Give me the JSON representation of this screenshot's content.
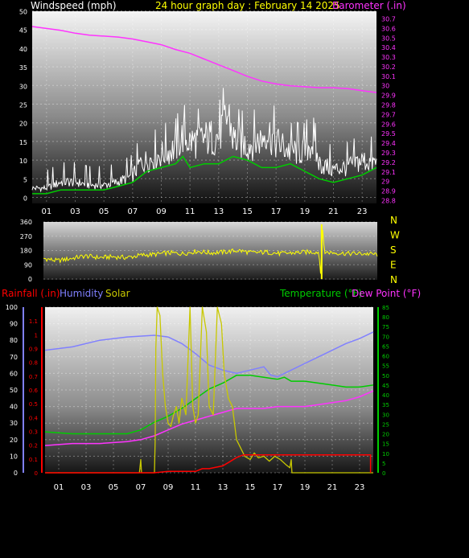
{
  "header": {
    "windspeed_label": "Windspeed (mph)",
    "title": "24 hour graph day : February 14 2025",
    "barometer_label": "Barometer (.in)"
  },
  "colors": {
    "background": "#000000",
    "axis_text": "#ffffff",
    "title": "#ffff00",
    "barometer": "#ff33ff",
    "wind_gust": "#ffffff",
    "wind_avg": "#00cc00",
    "direction": "#ffff00",
    "rainfall": "#ff0000",
    "humidity": "#8080ff",
    "solar": "#c8c800",
    "temperature": "#00cc00",
    "dewpoint": "#ff33ff"
  },
  "chart_data": [
    {
      "type": "line",
      "title": "24 hour graph day : February 14 2025",
      "x_ticks": [
        "01",
        "03",
        "05",
        "07",
        "09",
        "11",
        "13",
        "15",
        "17",
        "19",
        "21",
        "23"
      ],
      "y_left_label": "Windspeed (mph)",
      "y_left_ticks": [
        "0",
        "5",
        "10",
        "15",
        "20",
        "25",
        "30",
        "35",
        "40",
        "45",
        "50"
      ],
      "y_left_range": [
        0,
        50
      ],
      "y_right_label": "Barometer (.in)",
      "y_right_ticks": [
        "28.8",
        "28.9",
        "29",
        "29.1",
        "29.2",
        "29.3",
        "29.4",
        "29.5",
        "29.6",
        "29.7",
        "29.8",
        "29.9",
        "30",
        "30.1",
        "30.2",
        "30.3",
        "30.4",
        "30.5",
        "30.6",
        "30.7"
      ],
      "y_right_range": [
        28.77,
        30.78
      ],
      "x_range": [
        0,
        24
      ],
      "grid": true,
      "series": [
        {
          "name": "Windspeed (mph)",
          "axis": "left",
          "x": [
            0,
            1,
            2,
            3,
            4,
            5,
            6,
            7,
            7.5,
            8,
            9,
            10,
            10.5,
            11,
            12,
            13,
            13.7,
            14,
            15,
            16,
            16.3,
            17,
            18,
            19,
            19.5,
            20,
            21,
            22,
            23,
            24
          ],
          "values": [
            3,
            3,
            5,
            5,
            4,
            4,
            5,
            7,
            11,
            12,
            14,
            16,
            20,
            18,
            19,
            20,
            27,
            19,
            17,
            19,
            22,
            18,
            15,
            15,
            18,
            11,
            9,
            10,
            12,
            11
          ]
        },
        {
          "name": "Wind average",
          "axis": "left",
          "x": [
            0,
            1,
            2,
            3,
            4,
            5,
            6,
            7,
            8,
            9,
            10,
            10.5,
            11,
            12,
            13,
            14,
            15,
            16,
            17,
            18,
            19,
            20,
            21,
            22,
            23,
            24
          ],
          "values": [
            1,
            1,
            2,
            2,
            2,
            2,
            3,
            4,
            7,
            8,
            9,
            11,
            8,
            9,
            9,
            11,
            10,
            8,
            8,
            9,
            7,
            5,
            4,
            5,
            6,
            8
          ]
        },
        {
          "name": "Barometer (.in)",
          "axis": "right",
          "x": [
            0,
            1,
            2,
            3,
            4,
            5,
            6,
            7,
            8,
            9,
            10,
            11,
            12,
            13,
            14,
            15,
            16,
            17,
            18,
            19,
            20,
            21,
            22,
            23,
            24
          ],
          "values": [
            30.62,
            30.6,
            30.58,
            30.55,
            30.53,
            30.52,
            30.51,
            30.49,
            30.46,
            30.43,
            30.38,
            30.34,
            30.28,
            30.22,
            30.16,
            30.1,
            30.05,
            30.02,
            30.0,
            29.99,
            29.98,
            29.98,
            29.97,
            29.95,
            29.93
          ]
        }
      ]
    },
    {
      "type": "line",
      "x_range": [
        0,
        24
      ],
      "y_ticks": [
        "360",
        "270",
        "180",
        "90",
        "0"
      ],
      "y_range": [
        0,
        360
      ],
      "compass_labels": [
        "N",
        "W",
        "S",
        "E",
        "N"
      ],
      "series": [
        {
          "name": "Wind direction",
          "x": [
            0,
            1,
            2,
            3,
            4,
            5,
            6,
            7,
            8,
            9,
            10,
            11,
            12,
            13,
            14,
            15,
            16,
            17,
            18,
            19,
            19.8,
            19.95,
            20.05,
            20.2,
            21,
            22,
            23,
            24
          ],
          "values": [
            130,
            115,
            130,
            145,
            135,
            140,
            135,
            150,
            155,
            165,
            160,
            175,
            165,
            170,
            180,
            165,
            170,
            160,
            165,
            170,
            170,
            0,
            345,
            170,
            165,
            160,
            160,
            155
          ]
        }
      ]
    },
    {
      "type": "line",
      "x_ticks": [
        "01",
        "03",
        "05",
        "07",
        "09",
        "11",
        "13",
        "15",
        "17",
        "19",
        "21",
        "23"
      ],
      "x_range": [
        0,
        24
      ],
      "legend_left": [
        "Rainfall (.in)",
        "Humidity",
        "Solar"
      ],
      "legend_right": [
        "Temperature (°F)",
        "Dew Point (°F)"
      ],
      "y_humidity_ticks": [
        "0",
        "10",
        "20",
        "30",
        "40",
        "50",
        "60",
        "70",
        "80",
        "90",
        "100"
      ],
      "y_humidity_range": [
        0,
        100
      ],
      "y_rain_ticks": [
        "0",
        "0.1",
        "0.2",
        "0.3",
        "0.4",
        "0.5",
        "0.6",
        "0.7",
        "0.8",
        "0.9",
        "1",
        "1.1"
      ],
      "y_rain_range": [
        0,
        1.2
      ],
      "y_temp_ticks": [
        "0",
        "5",
        "10",
        "15",
        "20",
        "25",
        "30",
        "35",
        "40",
        "45",
        "50",
        "55",
        "60",
        "65",
        "70",
        "75",
        "80",
        "85"
      ],
      "y_temp_range": [
        0,
        85
      ],
      "grid": true,
      "series": [
        {
          "name": "Humidity",
          "axis": "humidity",
          "x": [
            0,
            2,
            4,
            6,
            8,
            9,
            10,
            11,
            12,
            13,
            14,
            15,
            16,
            16.5,
            17,
            18,
            19,
            20,
            21,
            22,
            23,
            24
          ],
          "values": [
            74,
            76,
            80,
            82,
            83,
            82,
            78,
            72,
            65,
            62,
            60,
            62,
            64,
            59,
            58,
            62,
            66,
            70,
            74,
            78,
            81,
            85
          ]
        },
        {
          "name": "Rainfall (.in)",
          "axis": "rain",
          "x": [
            0,
            8,
            9,
            10,
            11,
            11.5,
            12,
            13,
            13.5,
            14,
            14.5,
            15,
            18,
            20,
            22,
            23.8
          ],
          "values": [
            0,
            0,
            0.01,
            0.01,
            0.01,
            0.03,
            0.03,
            0.05,
            0.08,
            0.11,
            0.13,
            0.13,
            0.13,
            0.13,
            0.13,
            0.13
          ]
        },
        {
          "name": "Solar",
          "axis": "humidity",
          "x": [
            0,
            6.9,
            7.0,
            7.05,
            7.1,
            8.0,
            8.05,
            8.1,
            8.2,
            8.4,
            8.6,
            8.8,
            9.0,
            9.2,
            9.4,
            9.6,
            9.8,
            10.0,
            10.3,
            10.6,
            10.8,
            11.0,
            11.2,
            11.5,
            11.8,
            12.0,
            12.3,
            12.6,
            12.9,
            13.1,
            13.4,
            13.7,
            14.0,
            14.3,
            14.6,
            15.0,
            15.3,
            15.6,
            16.0,
            16.4,
            16.8,
            17.2,
            17.6,
            17.9,
            18.0,
            18.05,
            18.1,
            24
          ],
          "values": [
            0,
            0,
            8,
            0,
            0,
            0,
            20,
            75,
            100,
            95,
            60,
            40,
            30,
            28,
            35,
            40,
            30,
            45,
            35,
            100,
            40,
            30,
            35,
            100,
            85,
            40,
            35,
            100,
            90,
            60,
            45,
            40,
            20,
            15,
            10,
            8,
            12,
            9,
            10,
            7,
            10,
            8,
            5,
            3,
            8,
            0,
            0,
            0
          ]
        },
        {
          "name": "Temperature (°F)",
          "axis": "temp",
          "x": [
            0,
            2,
            4,
            6,
            7,
            8,
            9,
            10,
            11,
            12,
            13,
            14,
            15,
            16,
            17,
            17.5,
            18,
            19,
            20,
            21,
            22,
            23,
            24
          ],
          "values": [
            21,
            20,
            20,
            20,
            22,
            26,
            29,
            33,
            38,
            43,
            46,
            50,
            50,
            49,
            48,
            49,
            47,
            47,
            46,
            45,
            44,
            44,
            45
          ]
        },
        {
          "name": "Dew Point (°F)",
          "axis": "temp",
          "x": [
            0,
            2,
            4,
            6,
            7,
            8,
            9,
            10,
            11,
            12,
            13,
            14,
            15,
            16,
            17,
            18,
            19,
            20,
            21,
            22,
            23,
            24
          ],
          "values": [
            14,
            15,
            15,
            16,
            17,
            19,
            22,
            25,
            27,
            29,
            31,
            33,
            33,
            33,
            34,
            34,
            34,
            35,
            36,
            37,
            39,
            42
          ]
        }
      ]
    }
  ]
}
